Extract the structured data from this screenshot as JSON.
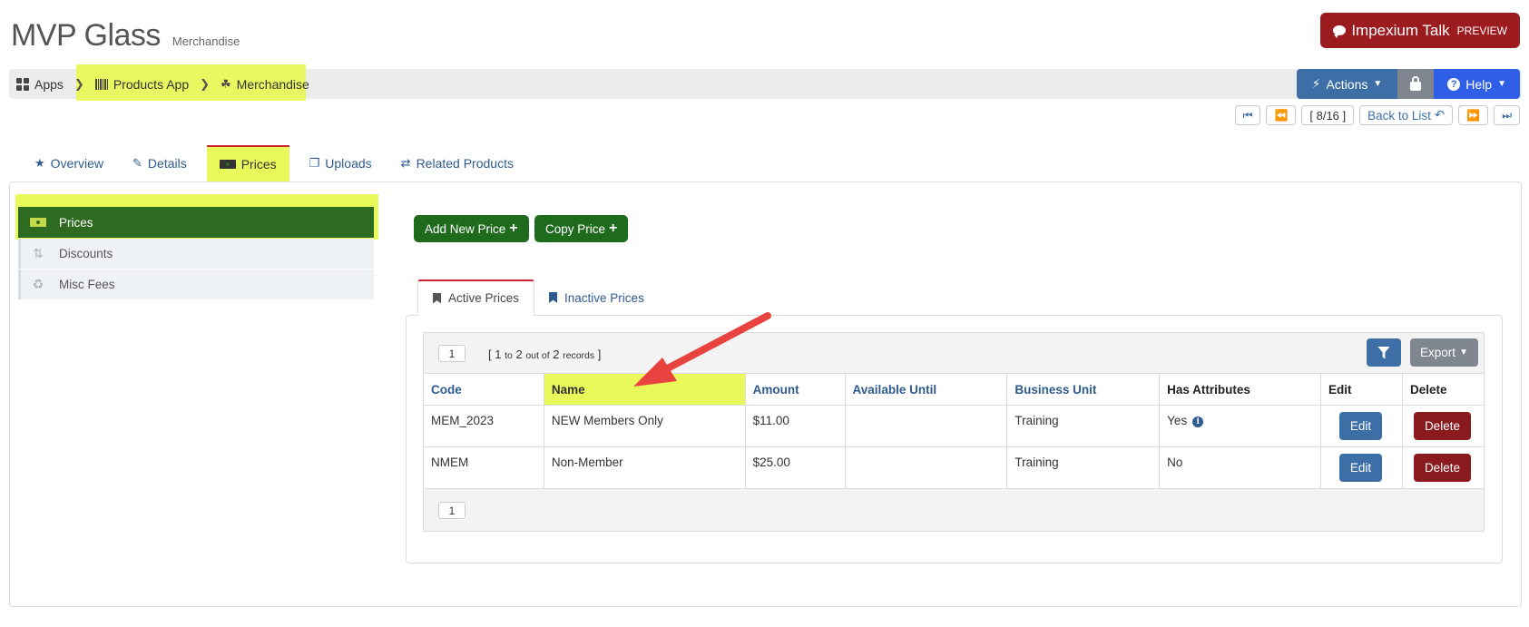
{
  "header": {
    "title": "MVP Glass",
    "subtitle": "Merchandise"
  },
  "talk": {
    "label": "Impexium Talk",
    "preview": "PREVIEW"
  },
  "breadcrumb": [
    {
      "label": "Apps",
      "icon": "grid-icon"
    },
    {
      "label": "Products App",
      "icon": "barcode-icon"
    },
    {
      "label": "Merchandise",
      "icon": "cubes-icon"
    }
  ],
  "toolbar": {
    "actions_label": "Actions",
    "help_label": "Help"
  },
  "pager": {
    "count": "[ 8/16 ]",
    "back_label": "Back to List"
  },
  "tabs": [
    {
      "label": "Overview",
      "icon": "star-icon"
    },
    {
      "label": "Details",
      "icon": "edit-icon"
    },
    {
      "label": "Prices",
      "icon": "money-icon"
    },
    {
      "label": "Uploads",
      "icon": "copy-icon"
    },
    {
      "label": "Related Products",
      "icon": "retweet-icon"
    }
  ],
  "sidebar": {
    "items": [
      {
        "label": "Prices",
        "icon": "money-icon"
      },
      {
        "label": "Discounts",
        "icon": "sort-amount-icon"
      },
      {
        "label": "Misc Fees",
        "icon": "recycle-icon"
      }
    ]
  },
  "buttons": {
    "add_price": "Add New Price",
    "copy_price": "Copy Price"
  },
  "subtabs": [
    {
      "label": "Active Prices"
    },
    {
      "label": "Inactive Prices"
    }
  ],
  "table": {
    "page": "1",
    "records": {
      "open": "[ ",
      "from": "1",
      "to_word": "to",
      "to": "2",
      "out_of": "out of",
      "total": "2",
      "word": "records",
      "close": " ]"
    },
    "export_label": "Export",
    "headers": [
      "Code",
      "Name",
      "Amount",
      "Available Until",
      "Business Unit",
      "Has Attributes",
      "Edit",
      "Delete"
    ],
    "rows": [
      {
        "code": "MEM_2023",
        "name": "NEW Members Only",
        "amount": "$11.00",
        "available_until": "",
        "business_unit": "Training",
        "has_attributes": "Yes",
        "edit": "Edit",
        "delete": "Delete"
      },
      {
        "code": "NMEM",
        "name": "Non-Member",
        "amount": "$25.00",
        "available_until": "",
        "business_unit": "Training",
        "has_attributes": "No",
        "edit": "Edit",
        "delete": "Delete"
      }
    ]
  },
  "colors": {
    "highlight": "#e9f85a",
    "arrow": "#e8433f",
    "primary": "#3d6fa6",
    "green": "#1e6b1e",
    "danger": "#8a1a1e"
  }
}
